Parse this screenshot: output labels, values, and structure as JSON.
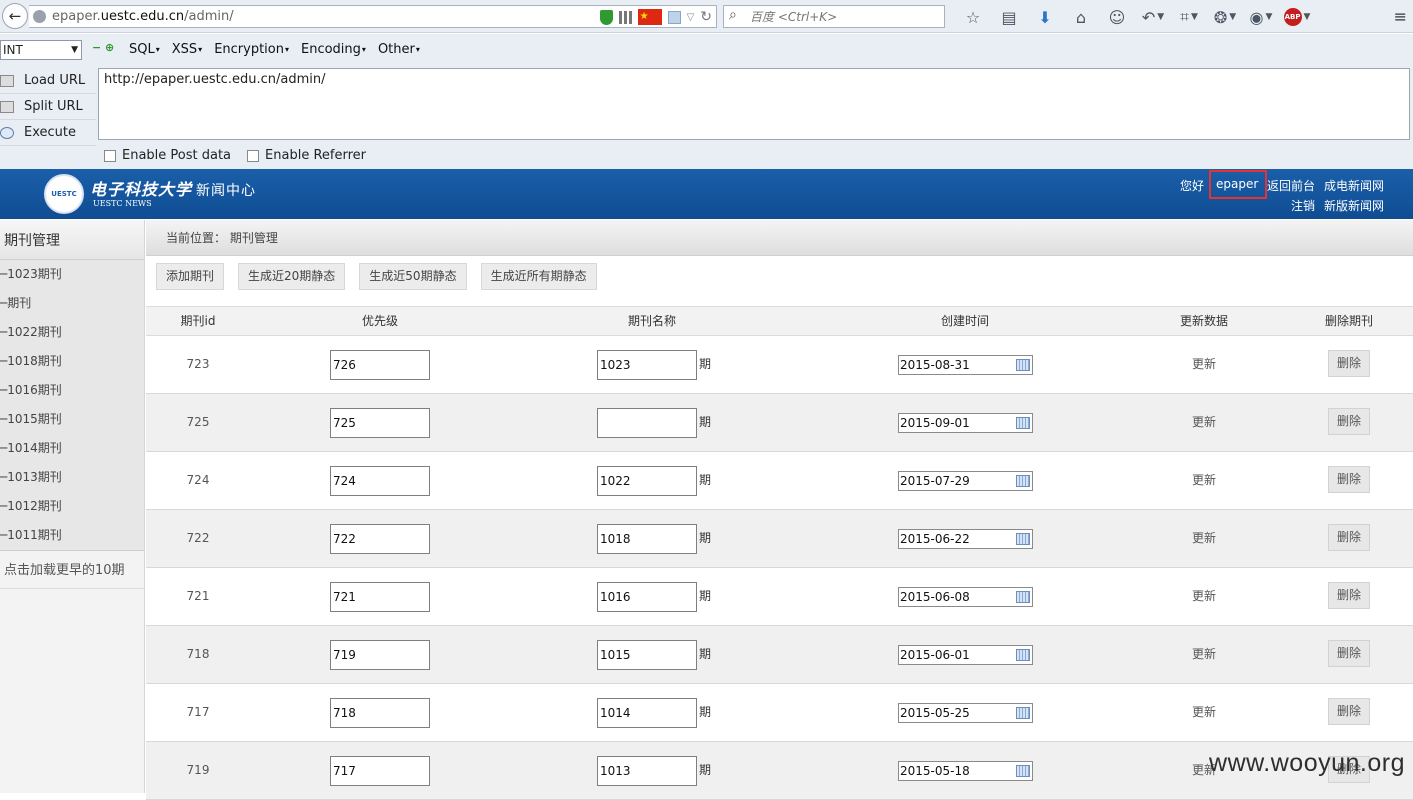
{
  "browser": {
    "url_prefix": "epaper.",
    "url_domain": "uestc.edu.cn",
    "url_path": "/admin/",
    "search_placeholder": "百度 <Ctrl+K>"
  },
  "hackbar": {
    "select_value": "INT",
    "menu": [
      "SQL",
      "XSS",
      "Encryption",
      "Encoding",
      "Other"
    ],
    "side": [
      "Load URL",
      "Split URL",
      "Execute"
    ],
    "url": "http://epaper.uestc.edu.cn/admin/",
    "enable_post": "Enable Post data",
    "enable_referrer": "Enable Referrer"
  },
  "site": {
    "logo_cn": "电子科技大学",
    "logo_sub": "新闻中心",
    "logo_en": "UESTC NEWS",
    "seal_text": "UESTC",
    "greeting": "您好",
    "username": "epaper",
    "back_front": "返回前台",
    "chengdian": "成电新闻网",
    "logout": "注销",
    "new_news": "新版新闻网"
  },
  "sidebar": {
    "title": "期刊管理",
    "items": [
      "─1023期刊",
      "─期刊",
      "─1022期刊",
      "─1018期刊",
      "─1016期刊",
      "─1015期刊",
      "─1014期刊",
      "─1013期刊",
      "─1012期刊",
      "─1011期刊"
    ],
    "load_more": "点击加载更早的10期"
  },
  "main": {
    "breadcrumb": "当前位置： 期刊管理",
    "actions": [
      "添加期刊",
      "生成近20期静态",
      "生成近50期静态",
      "生成近所有期静态"
    ],
    "columns": [
      "期刊id",
      "优先级",
      "期刊名称",
      "创建时间",
      "更新数据",
      "删除期刊"
    ],
    "issue_suffix": "期",
    "update_label": "更新",
    "delete_label": "删除",
    "rows": [
      {
        "id": "723",
        "priority": "726",
        "name": "1023",
        "date": "2015-08-31"
      },
      {
        "id": "725",
        "priority": "725",
        "name": "",
        "date": "2015-09-01"
      },
      {
        "id": "724",
        "priority": "724",
        "name": "1022",
        "date": "2015-07-29"
      },
      {
        "id": "722",
        "priority": "722",
        "name": "1018",
        "date": "2015-06-22"
      },
      {
        "id": "721",
        "priority": "721",
        "name": "1016",
        "date": "2015-06-08"
      },
      {
        "id": "718",
        "priority": "719",
        "name": "1015",
        "date": "2015-06-01"
      },
      {
        "id": "717",
        "priority": "718",
        "name": "1014",
        "date": "2015-05-25"
      },
      {
        "id": "719",
        "priority": "717",
        "name": "1013",
        "date": "2015-05-18"
      }
    ]
  },
  "watermark": "www.wooyun.org"
}
